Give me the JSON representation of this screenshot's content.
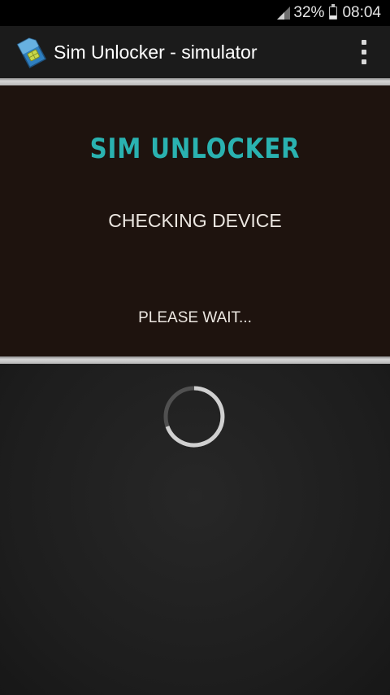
{
  "status_bar": {
    "battery_percent": "32%",
    "battery_level": 0.32,
    "time": "08:04",
    "icons": [
      "signal-icon",
      "battery-icon"
    ]
  },
  "action_bar": {
    "icon": "sim-card-icon",
    "title": "Sim Unlocker - simulator",
    "menu_icon": "overflow-menu-icon"
  },
  "panel": {
    "brand": "SIM UNLOCKER",
    "status": "CHECKING DEVICE",
    "wait": "PLEASE WAIT..."
  },
  "colors": {
    "brand": "#2ab2b0",
    "panel_bg": "#1e130e",
    "spinner": "#d0d0d0"
  },
  "loading_icon": "loading-spinner-icon"
}
